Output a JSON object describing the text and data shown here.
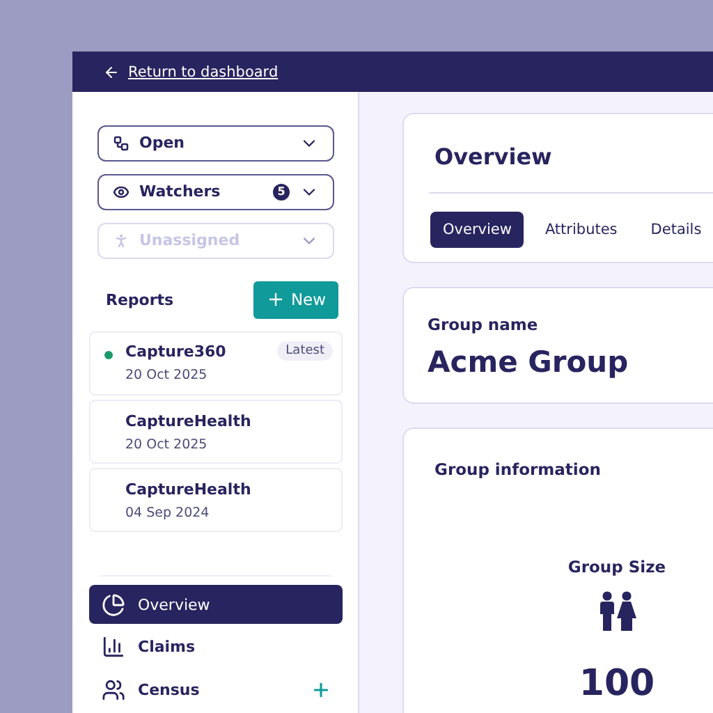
{
  "header": {
    "back_link": "Return to dashboard"
  },
  "selects": [
    {
      "label": "Open",
      "disabled": false
    },
    {
      "label": "Watchers",
      "badge": "5",
      "disabled": false
    },
    {
      "label": "Unassigned",
      "disabled": true
    }
  ],
  "reports": {
    "title": "Reports",
    "new_button": "New",
    "items": [
      {
        "name": "Capture360",
        "date": "20 Oct 2025",
        "badge": "Latest",
        "color": "#1a9a6c"
      },
      {
        "name": "CaptureHealth",
        "date": "20 Oct 2025"
      },
      {
        "name": "CaptureHealth",
        "date": "04 Sep 2024"
      }
    ]
  },
  "nav": [
    {
      "label": "Overview",
      "selected": true,
      "addable": false
    },
    {
      "label": "Claims",
      "selected": false,
      "addable": false
    },
    {
      "label": "Census",
      "selected": false,
      "addable": true
    }
  ],
  "page": {
    "title": "Overview",
    "tabs": [
      {
        "label": "Overview",
        "selected": true
      },
      {
        "label": "Attributes",
        "selected": false
      },
      {
        "label": "Details",
        "selected": false
      }
    ]
  },
  "group_name": {
    "label": "Group name",
    "value": "Acme Group"
  },
  "group_info": {
    "title": "Group information",
    "stat_label": "Group Size",
    "stat_value": "100"
  }
}
